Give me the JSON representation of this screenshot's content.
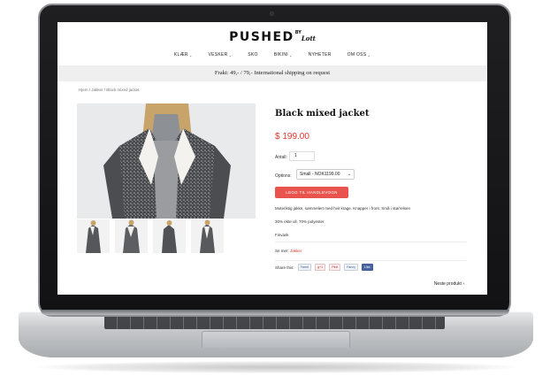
{
  "site": {
    "logo_text": "PUSHED",
    "logo_by": "BY",
    "logo_signature": "Lott"
  },
  "nav": {
    "items": [
      {
        "label": "KLÆR",
        "has_dropdown": true
      },
      {
        "label": "VESKER",
        "has_dropdown": true
      },
      {
        "label": "SKO",
        "has_dropdown": false
      },
      {
        "label": "BIKINI",
        "has_dropdown": true
      },
      {
        "label": "NYHETER",
        "has_dropdown": false
      },
      {
        "label": "OM OSS",
        "has_dropdown": true
      }
    ],
    "dropdown_glyph": "⌄"
  },
  "shipping_bar": {
    "text": "Frakt: 49,- / 79,- International shipping on request"
  },
  "breadcrumb": {
    "text": "Hjem / Jakker / Black mixed jacket"
  },
  "product": {
    "title": "Black mixed jacket",
    "price": "$ 199.00",
    "quantity_label": "Antall:",
    "quantity_value": "1",
    "options_label": "Options:",
    "options_selected": "Small - NOK1199.00",
    "options_caret": "⌄",
    "add_to_cart_label": "LEGG TIL HANDLEVOGN",
    "description_1": "Moteriktig jakke, sømmelert med hvit krage. Knapper i front. Små i størrelsen",
    "description_2": "30% ekte ull, 70% polyester.",
    "description_3": "Finvask",
    "see_more_label": "Se mer:",
    "see_more_link": "Jakker",
    "share_label": "Share this:",
    "share_buttons": [
      "Tweet",
      "g+1",
      "Pinit",
      "Fancy",
      "Like"
    ],
    "next_label": "Neste produkt ›"
  },
  "colors": {
    "accent_red": "#e0342c",
    "button_red": "#e8534e"
  },
  "icons": {
    "dropdown": "chevron-down-icon"
  }
}
